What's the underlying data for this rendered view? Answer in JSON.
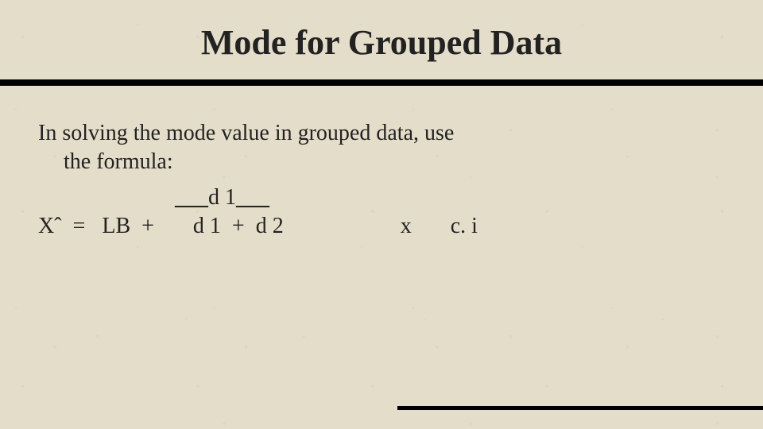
{
  "title": "Mode for Grouped Data",
  "intro_line1": "In solving the mode value in grouped data, use",
  "intro_line2": "the formula:",
  "formula": {
    "numerator_pre": "___",
    "numerator_mid": "d 1",
    "numerator_post": "___",
    "row": "Xˆ  =   LB  +       d 1  +  d 2                     x       c. i"
  }
}
